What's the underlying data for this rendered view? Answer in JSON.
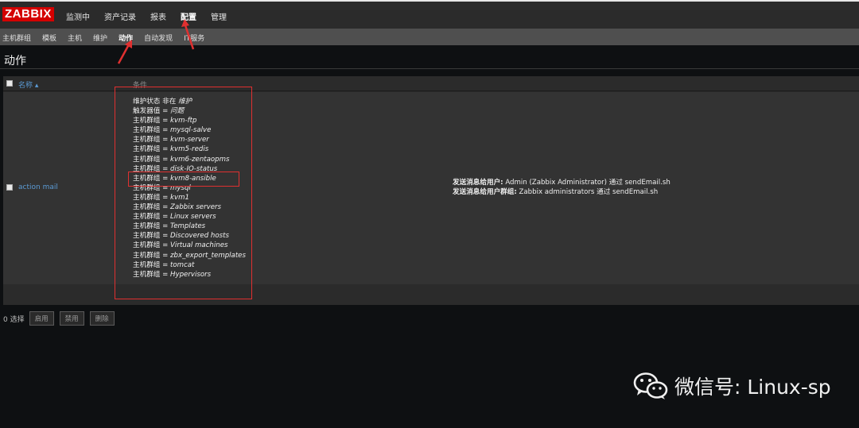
{
  "logo": "ZABBIX",
  "main_menu": [
    {
      "label": "监测中",
      "active": false
    },
    {
      "label": "资产记录",
      "active": false
    },
    {
      "label": "报表",
      "active": false
    },
    {
      "label": "配置",
      "active": true
    },
    {
      "label": "管理",
      "active": false
    }
  ],
  "sub_menu": [
    {
      "label": "主机群组",
      "active": false
    },
    {
      "label": "模板",
      "active": false
    },
    {
      "label": "主机",
      "active": false
    },
    {
      "label": "维护",
      "active": false
    },
    {
      "label": "动作",
      "active": true
    },
    {
      "label": "自动发现",
      "active": false
    },
    {
      "label": "IT服务",
      "active": false
    }
  ],
  "page_title": "动作",
  "table": {
    "headers": {
      "name": "名称 ▴",
      "conditions": "条件",
      "operations": "操作"
    },
    "rows": [
      {
        "name": "action mail",
        "conditions": [
          {
            "label": "维护状态 非在",
            "value": "维护"
          },
          {
            "label": "触发器值 =",
            "value": "问题"
          },
          {
            "label": "主机群组 =",
            "value": "kvm-ftp"
          },
          {
            "label": "主机群组 =",
            "value": "mysql-salve"
          },
          {
            "label": "主机群组 =",
            "value": "kvm-server"
          },
          {
            "label": "主机群组 =",
            "value": "kvm5-redis"
          },
          {
            "label": "主机群组 =",
            "value": "kvm6-zentaopms"
          },
          {
            "label": "主机群组 =",
            "value": "disk-IO-status"
          },
          {
            "label": "主机群组 =",
            "value": "kvm8-ansible"
          },
          {
            "label": "主机群组 =",
            "value": "mysql"
          },
          {
            "label": "主机群组 =",
            "value": "kvm1"
          },
          {
            "label": "主机群组 =",
            "value": "Zabbix servers"
          },
          {
            "label": "主机群组 =",
            "value": "Linux servers"
          },
          {
            "label": "主机群组 =",
            "value": "Templates"
          },
          {
            "label": "主机群组 =",
            "value": "Discovered hosts"
          },
          {
            "label": "主机群组 =",
            "value": "Virtual machines"
          },
          {
            "label": "主机群组 =",
            "value": "zbx_export_templates"
          },
          {
            "label": "主机群组 =",
            "value": "tomcat"
          },
          {
            "label": "主机群组 =",
            "value": "Hypervisors"
          }
        ],
        "operations": [
          {
            "label": "发送消息给用户:",
            "text": "Admin (Zabbix Administrator) 通过 sendEmail.sh"
          },
          {
            "label": "发送消息给用户群组:",
            "text": "Zabbix administrators 通过 sendEmail.sh"
          }
        ]
      }
    ]
  },
  "footer": {
    "selected": "0 选择",
    "buttons": [
      "启用",
      "禁用",
      "删除"
    ]
  },
  "watermark": {
    "text": "微信号: Linux-sp",
    "icon": "wechat-icon"
  },
  "colors": {
    "logo_bg": "#d40000",
    "link": "#5b9bd5",
    "annotation": "#e03030",
    "topbar": "#2b2b2b",
    "subbar": "#4f4f4f"
  }
}
